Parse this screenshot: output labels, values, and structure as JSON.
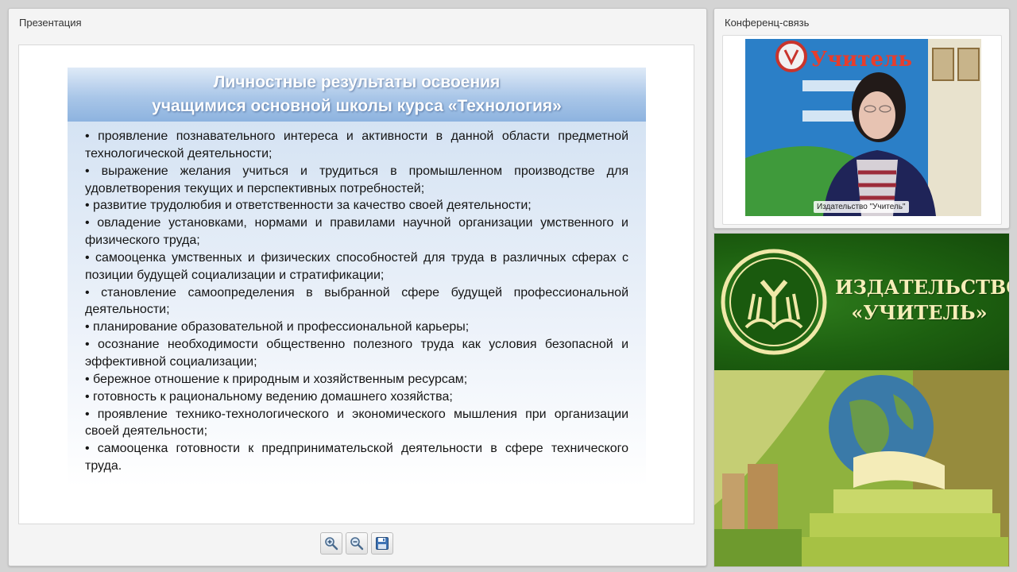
{
  "presentation": {
    "title": "Презентация",
    "slide": {
      "heading_line1": "Личностные результаты  освоения",
      "heading_line2": "учащимися основной школы курса «Технология»",
      "bullets": [
        "• проявление познавательного интереса и активности в данной области предметной технологической деятельности;",
        "• выражение желания учиться и трудиться в промышленном производстве для удовлетворения текущих и перспективных потребностей;",
        "• развитие трудолюбия и ответственности за качество своей деятельности;",
        "• овладение установками, нормами и правилами научной организации умственного и физического труда;",
        "• самооценка умственных и физических способностей для труда в различных сферах с позиции будущей социализации и стратификации;",
        "• становление самоопределения в выбранной сфере будущей профессиональной деятельности;",
        "• планирование образовательной и профессиональной карьеры;",
        "• осознание необходимости общественно полезного труда как условия безопасной и эффективной социализации;",
        "• бережное отношение к природным и хозяйственным ресурсам;",
        "• готовность к рациональному ведению домашнего хозяйства;",
        "• проявление технико-технологического и экономического мышления при организации своей деятельности;",
        "• самооценка готовности к предпринимательской деятельности в сфере технического труда."
      ]
    },
    "toolbar": {
      "zoom_in_icon": "zoom-in-icon",
      "zoom_out_icon": "zoom-out-icon",
      "save_icon": "floppy-disk-icon"
    }
  },
  "conference": {
    "title": "Конференц-связь",
    "video": {
      "caption": "Издательство \"Учитель\"",
      "backdrop_text": "Учитель"
    }
  },
  "banner": {
    "line1": "ИЗДАТЕЛЬСТВО",
    "line2": "«УЧИТЕЛЬ»"
  },
  "colors": {
    "slide_heading_blue": "#8db3df",
    "banner_green": "#1d6010",
    "banner_text": "#f6eeb8"
  }
}
